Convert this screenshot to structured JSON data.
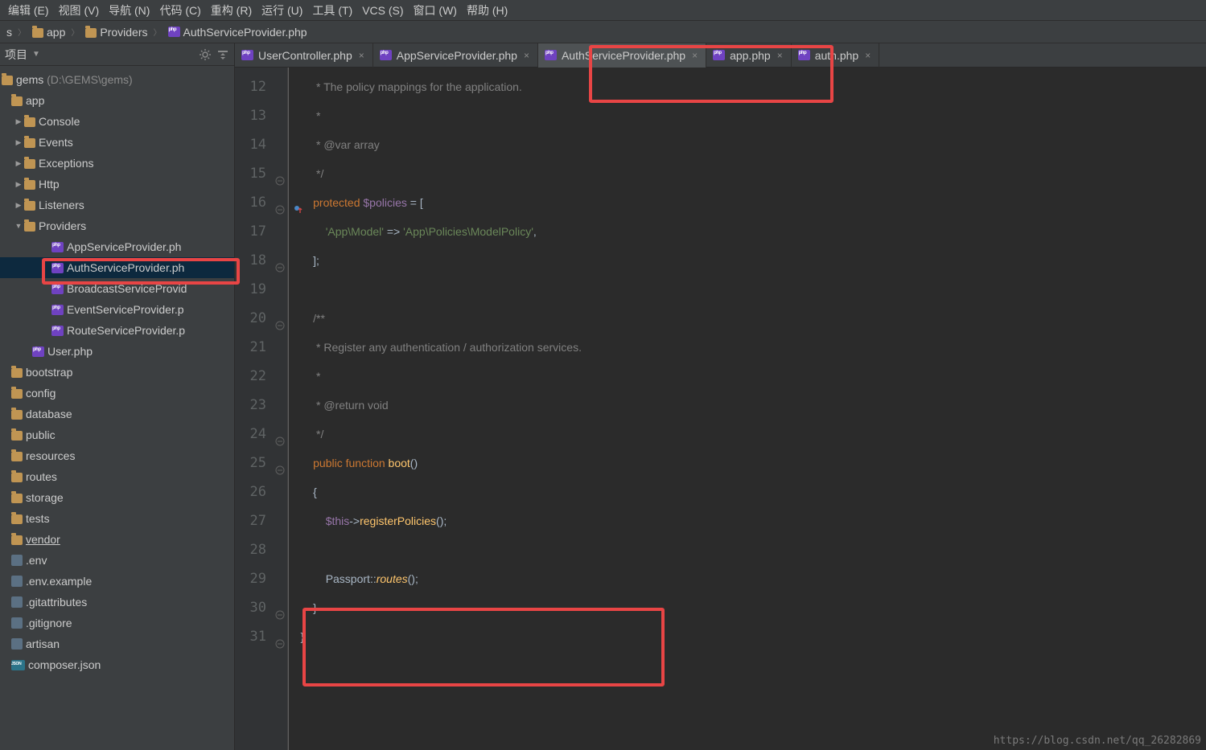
{
  "menu": {
    "edit": "编辑 (E)",
    "view": "视图 (V)",
    "nav": "导航 (N)",
    "code": "代码 (C)",
    "refactor": "重构 (R)",
    "run": "运行 (U)",
    "tools": "工具 (T)",
    "vcs": "VCS (S)",
    "window": "窗口 (W)",
    "help": "帮助 (H)"
  },
  "crumbs": {
    "a": "s",
    "app": "app",
    "providers": "Providers",
    "file": "AuthServiceProvider.php"
  },
  "sidebar": {
    "title": "项目",
    "root": {
      "name": "gems",
      "path": " (D:\\GEMS\\gems)"
    },
    "app": "app",
    "appChildren": [
      "Console",
      "Events",
      "Exceptions",
      "Http",
      "Listeners",
      "Providers"
    ],
    "providersChildren": [
      "AppServiceProvider.ph",
      "AuthServiceProvider.ph",
      "BroadcastServiceProvid",
      "EventServiceProvider.p",
      "RouteServiceProvider.p"
    ],
    "userphp": "User.php",
    "topFolders": [
      "bootstrap",
      "config",
      "database",
      "public",
      "resources",
      "routes",
      "storage",
      "tests",
      "vendor"
    ],
    "files": [
      ".env",
      ".env.example",
      ".gitattributes",
      ".gitignore",
      "artisan",
      "composer.json"
    ]
  },
  "tabs": [
    {
      "label": "UserController.php",
      "active": false
    },
    {
      "label": "AppServiceProvider.php",
      "active": false
    },
    {
      "label": "AuthServiceProvider.php",
      "active": true
    },
    {
      "label": "app.php",
      "active": false
    },
    {
      "label": "auth.php",
      "active": false
    }
  ],
  "code": {
    "lines": [
      {
        "n": 12,
        "t": "         * The policy mappings for the application.",
        "cls": "cmt"
      },
      {
        "n": 13,
        "t": "         *",
        "cls": "cmt"
      },
      {
        "n": 14,
        "t": "         * @var array",
        "cls": "cmt"
      },
      {
        "n": 15,
        "t": "         */",
        "cls": "cmt"
      },
      {
        "n": 16
      },
      {
        "n": 17
      },
      {
        "n": 18
      },
      {
        "n": 19,
        "t": "",
        "cls": ""
      },
      {
        "n": 20,
        "t": "        /**",
        "cls": "cmt"
      },
      {
        "n": 21,
        "t": "         * Register any authentication / authorization services.",
        "cls": "cmt"
      },
      {
        "n": 22,
        "t": "         *",
        "cls": "cmt"
      },
      {
        "n": 23,
        "t": "         * @return void",
        "cls": "cmt"
      },
      {
        "n": 24,
        "t": "         */",
        "cls": "cmt"
      },
      {
        "n": 25
      },
      {
        "n": 26,
        "t": "        {",
        "cls": ""
      },
      {
        "n": 27
      },
      {
        "n": 28,
        "t": "",
        "cls": ""
      },
      {
        "n": 29
      },
      {
        "n": 30,
        "t": "        }",
        "cls": ""
      },
      {
        "n": 31
      }
    ],
    "l16": {
      "kw": "protected",
      "var": "$policies",
      "rest": " = ["
    },
    "l17": {
      "s1": "'App\\Model'",
      "arrow": " => ",
      "s2": "'App\\Policies\\ModelPolicy'",
      "end": ","
    },
    "l18": {
      "t": "        ];"
    },
    "l25": {
      "kw1": "public",
      "kw2": "function",
      "fn": "boot",
      "rest": "()"
    },
    "l27": {
      "var": "$this",
      "arrow": "->",
      "fn": "registerPolicies",
      "rest": "();"
    },
    "l29": {
      "cls": "Passport",
      "op": "::",
      "fn": "routes",
      "rest": "();"
    },
    "l31": {
      "t": "    }"
    }
  },
  "watermark": "https://blog.csdn.net/qq_26282869"
}
